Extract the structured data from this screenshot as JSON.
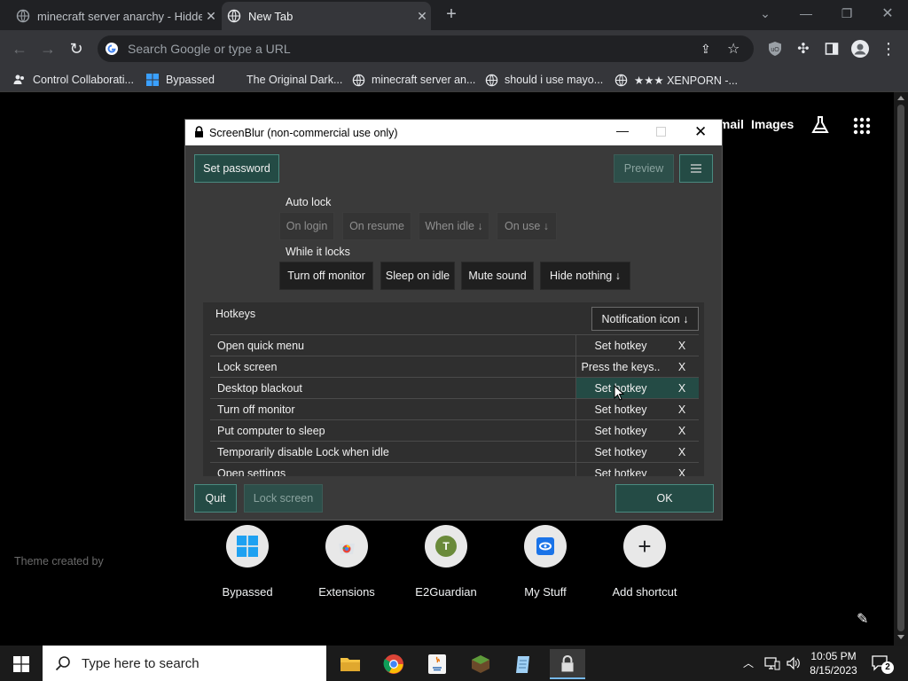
{
  "browser": {
    "tabs": [
      {
        "title": "minecraft server anarchy - Hidde",
        "active": false
      },
      {
        "title": "New Tab",
        "active": true
      }
    ],
    "omnibox_placeholder": "Search Google or type a URL",
    "bookmarks": [
      {
        "label": "Control Collaborati...",
        "icon": "user-group-icon"
      },
      {
        "label": "Bypassed",
        "icon": "windows-icon"
      },
      {
        "label": "The Original Dark...",
        "icon": "none"
      },
      {
        "label": "minecraft server an...",
        "icon": "globe-icon"
      },
      {
        "label": "should i use mayo...",
        "icon": "globe-icon"
      },
      {
        "label": "★★★ XENPORN -...",
        "icon": "globe-icon"
      }
    ]
  },
  "ntp": {
    "top_links": {
      "gmail": "Gmail",
      "images": "Images"
    },
    "theme_credit": "Theme created by",
    "shortcuts": [
      {
        "label": "Bypassed",
        "icon": "windows-icon"
      },
      {
        "label": "Extensions",
        "icon": "chrome-web-store-icon"
      },
      {
        "label": "E2Guardian",
        "icon": "letter-t-avatar-icon",
        "letter": "T"
      },
      {
        "label": "My Stuff",
        "icon": "my-stuff-icon"
      },
      {
        "label": "Add shortcut",
        "icon": "plus-icon"
      }
    ]
  },
  "dialog": {
    "title": "ScreenBlur (non-commercial use only)",
    "set_password": "Set password",
    "preview": "Preview",
    "auto_lock_label": "Auto lock",
    "auto_lock_options": [
      "On login",
      "On resume",
      "When idle ↓",
      "On use ↓"
    ],
    "while_locks_label": "While it locks",
    "while_locks_options": [
      "Turn off monitor",
      "Sleep on idle",
      "Mute sound",
      "Hide nothing ↓"
    ],
    "hotkeys_label": "Hotkeys",
    "notification_select": "Notification icon ↓",
    "hotkeys": [
      {
        "name": "Open quick menu",
        "shortcut": "Set hotkey",
        "clear": "X"
      },
      {
        "name": "Lock screen",
        "shortcut": "Press the keys..",
        "clear": "X"
      },
      {
        "name": "Desktop blackout",
        "shortcut": "Set hotkey",
        "clear": "X"
      },
      {
        "name": "Turn off monitor",
        "shortcut": "Set hotkey",
        "clear": "X"
      },
      {
        "name": "Put computer to sleep",
        "shortcut": "Set hotkey",
        "clear": "X"
      },
      {
        "name": "Temporarily disable Lock when idle",
        "shortcut": "Set hotkey",
        "clear": "X"
      },
      {
        "name": "Open settings",
        "shortcut": "Set hotkey",
        "clear": "X"
      }
    ],
    "quit": "Quit",
    "lock_screen": "Lock screen",
    "ok": "OK"
  },
  "taskbar": {
    "search_placeholder": "Type here to search",
    "time": "10:05 PM",
    "date": "8/15/2023",
    "notification_count": "2"
  }
}
